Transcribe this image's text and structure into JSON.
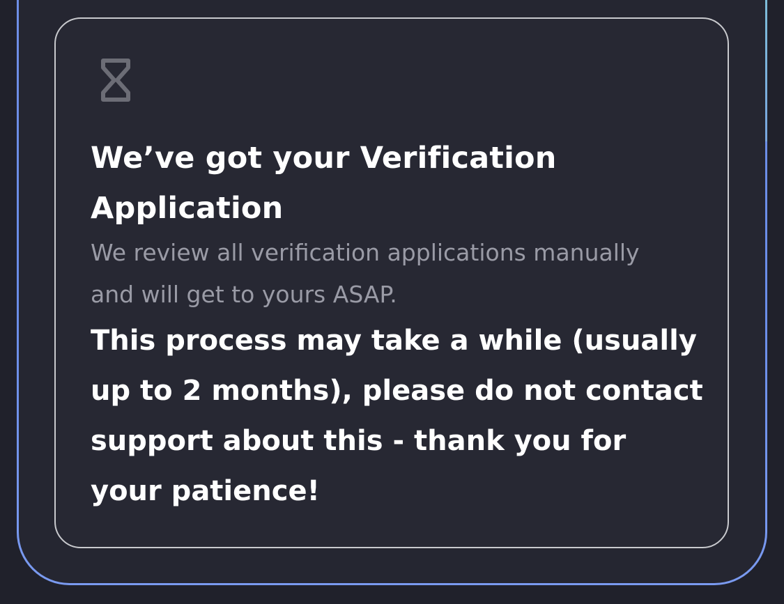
{
  "card": {
    "icon": "hourglass-icon",
    "title": "We’ve got your Verification Application",
    "subtitle": "We review all verification applications manually and will get to yours ASAP.",
    "notice": "This process may take a while (usually up to 2 months), please do not contact support about this - thank you for your patience!"
  },
  "colors": {
    "background": "#20212b",
    "panel": "#252631",
    "card": "#272833",
    "card_border": "#c9cace",
    "accent_border": "#6f8fe6",
    "text_primary": "#ffffff",
    "text_secondary": "#9a9ba6",
    "icon": "#6c6d76"
  }
}
